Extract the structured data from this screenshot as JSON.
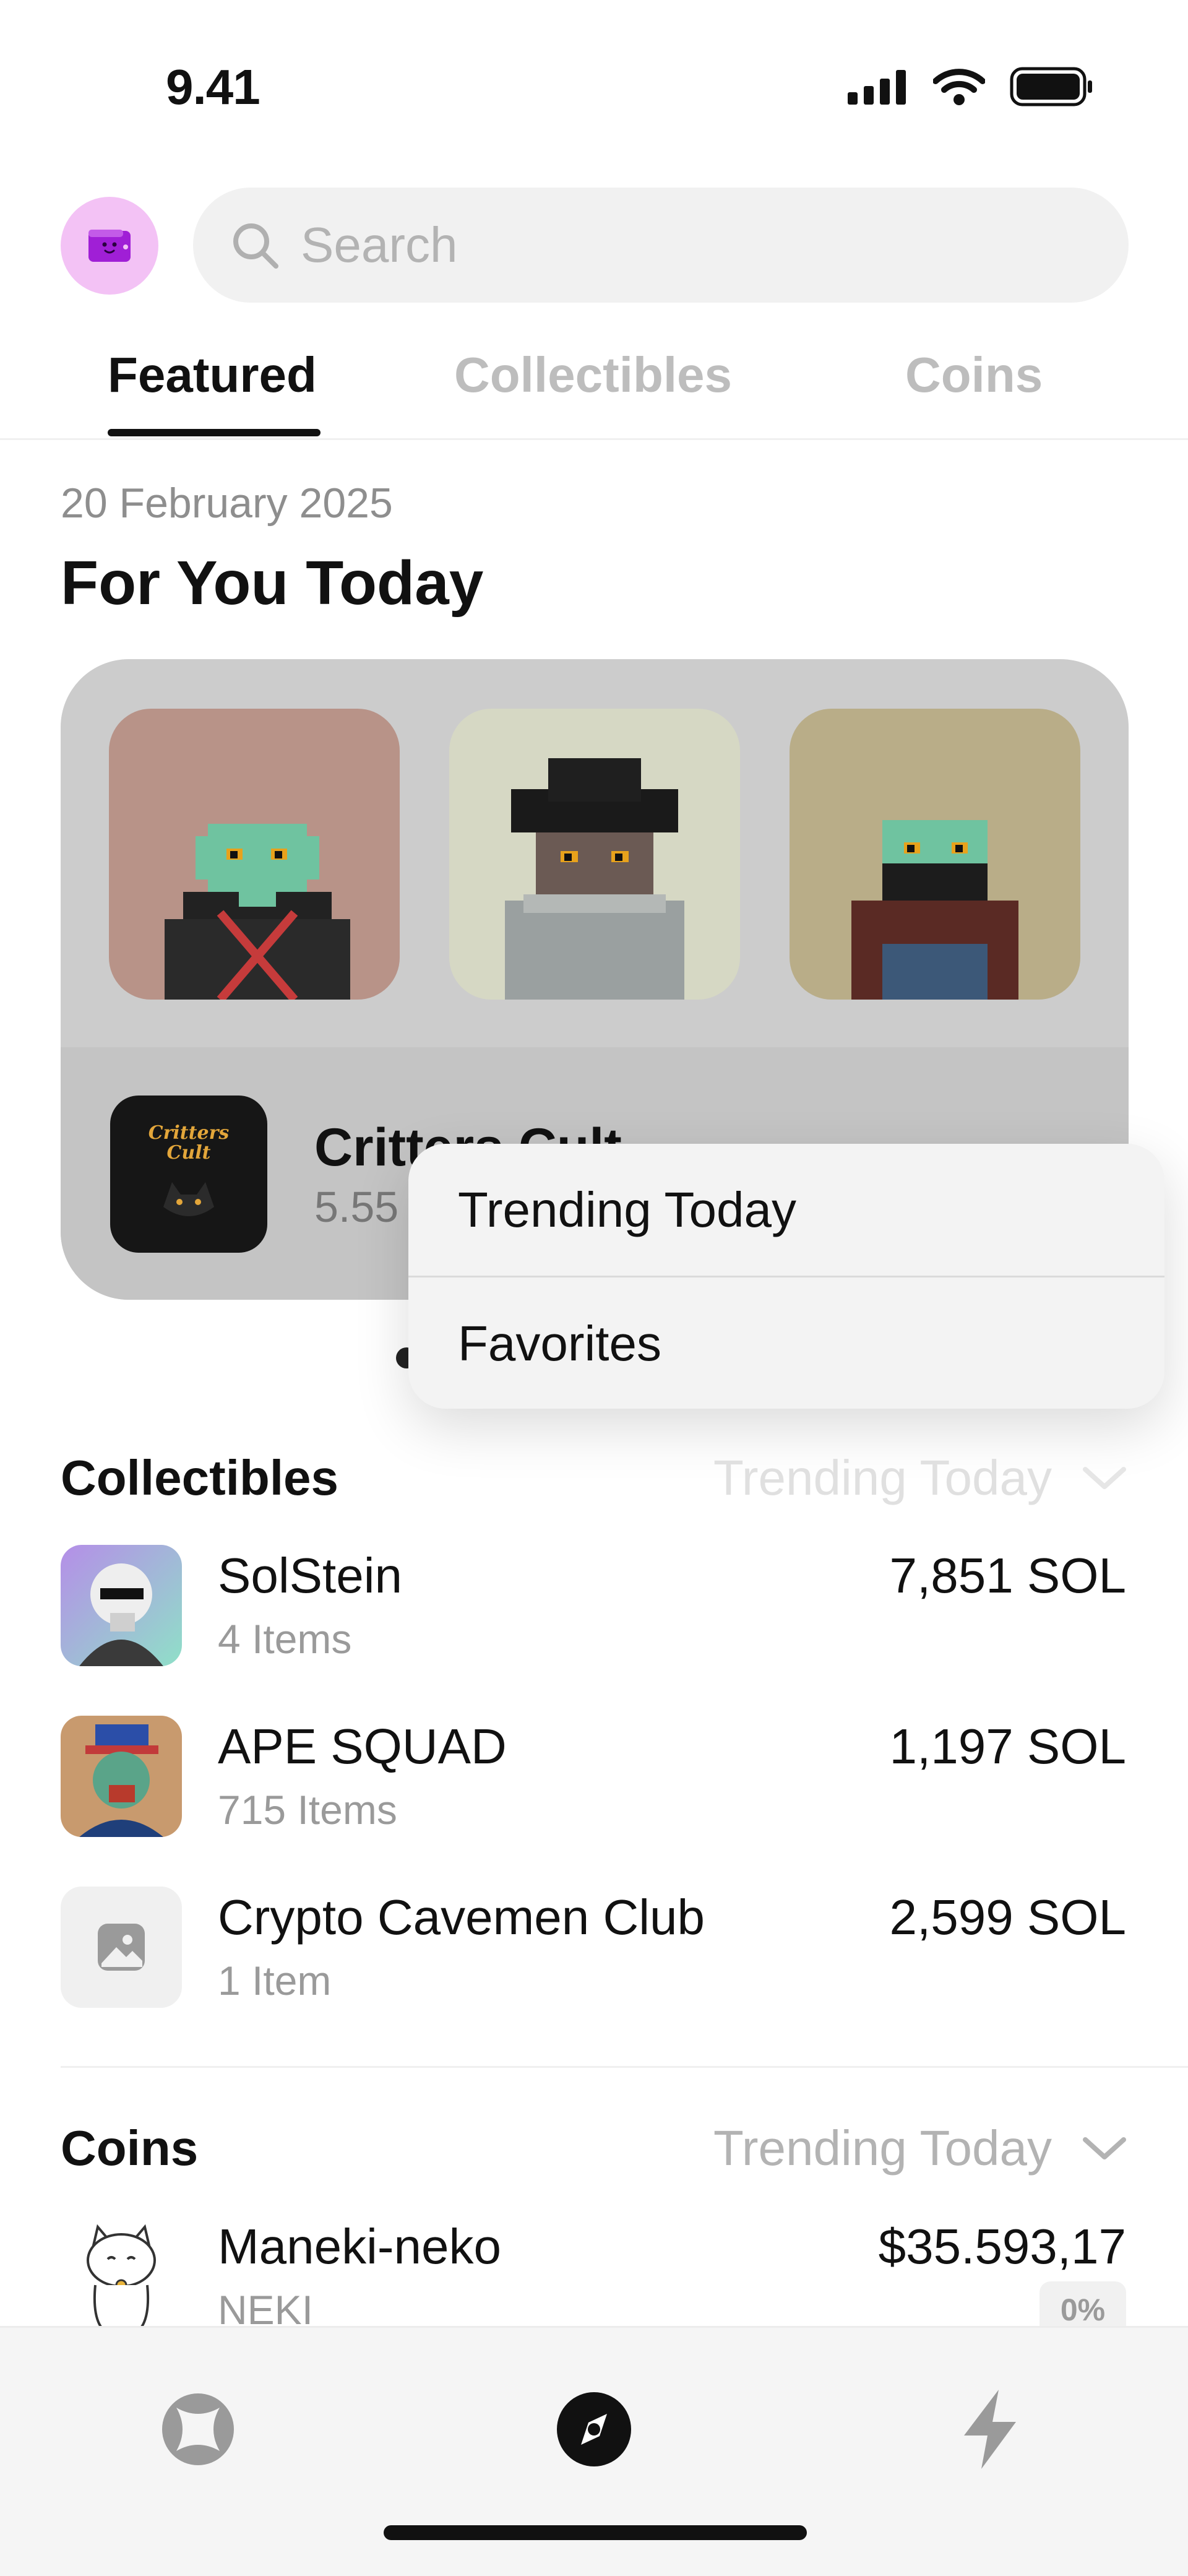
{
  "status_bar": {
    "time": "9.41",
    "icons": [
      "signal-icon",
      "wifi-icon",
      "battery-icon"
    ]
  },
  "header": {
    "wallet_icon": "wallet-icon",
    "search": {
      "placeholder": "Search"
    }
  },
  "tabs": [
    {
      "label": "Featured",
      "active": true
    },
    {
      "label": "Collectibles",
      "active": false
    },
    {
      "label": "Coins",
      "active": false
    }
  ],
  "featured": {
    "date": "20 February 2025",
    "title": "For You Today",
    "collection": {
      "name": "Critters Cult",
      "sub": "5.55",
      "logo_text": "Critters Cult"
    }
  },
  "dropdown": {
    "items": [
      "Trending Today",
      "Favorites"
    ]
  },
  "collectibles": {
    "title": "Collectibles",
    "filter": "Trending Today",
    "items": [
      {
        "name": "SolStein",
        "sub": "4 Items",
        "value": "7,851 SOL"
      },
      {
        "name": "APE SQUAD",
        "sub": "715 Items",
        "value": "1,197 SOL"
      },
      {
        "name": "Crypto Cavemen Club",
        "sub": "1 Item",
        "value": "2,599 SOL"
      }
    ]
  },
  "coins": {
    "title": "Coins",
    "filter": "Trending Today",
    "items": [
      {
        "name": "Maneki-neko",
        "sub": "NEKI",
        "value": "$35.593,17",
        "change": "0%"
      }
    ]
  },
  "bottom_nav": {
    "items": [
      "explore-icon",
      "discover-icon",
      "activity-icon"
    ],
    "active": 1
  },
  "colors": {
    "wallet_bg": "#f3c2f5",
    "wallet_icon": "#a01fd6",
    "accent": "#111111"
  }
}
